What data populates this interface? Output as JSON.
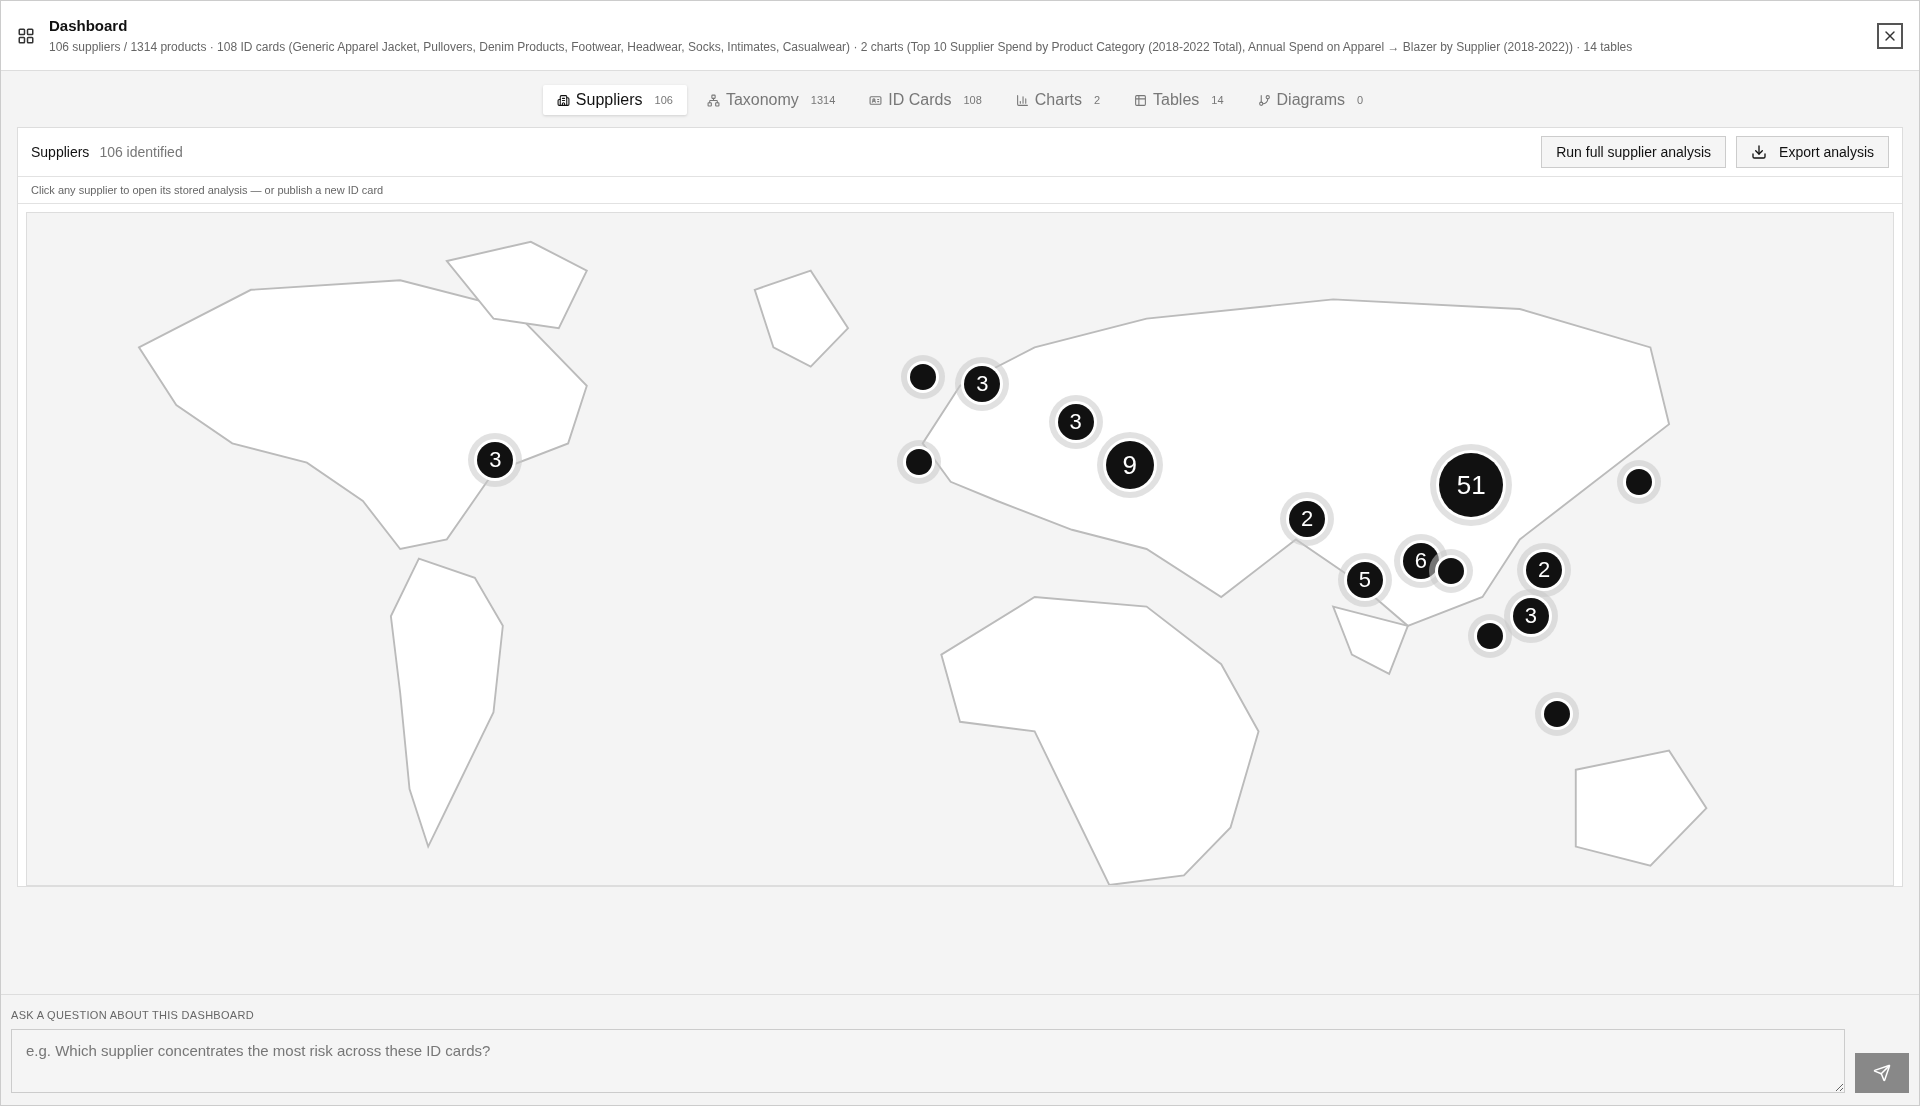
{
  "header": {
    "title": "Dashboard",
    "subtitle": "106 suppliers / 1314 products · 108 ID cards (Generic Apparel Jacket, Pullovers, Denim Products, Footwear, Headwear, Socks, Intimates, Casualwear) · 2 charts (Top 10 Supplier Spend by Product Category (2018-2022 Total), Annual Spend on Apparel → Blazer by Supplier (2018-2022)) · 14 tables"
  },
  "tabs": [
    {
      "kind": "suppliers",
      "label": "Suppliers",
      "count": "106",
      "selected": true
    },
    {
      "kind": "taxonomy",
      "label": "Taxonomy",
      "count": "1314",
      "selected": false
    },
    {
      "kind": "idcards",
      "label": "ID Cards",
      "count": "108",
      "selected": false
    },
    {
      "kind": "charts",
      "label": "Charts",
      "count": "2",
      "selected": false
    },
    {
      "kind": "tables",
      "label": "Tables",
      "count": "14",
      "selected": false
    },
    {
      "kind": "diagrams",
      "label": "Diagrams",
      "count": "0",
      "selected": false
    }
  ],
  "panel": {
    "title": "Suppliers",
    "count": "106 identified",
    "buttons": [
      {
        "kind": "plain",
        "label": "Run full supplier analysis"
      },
      {
        "kind": "export",
        "label": "Export analysis"
      }
    ],
    "hint": "Click any supplier to open its stored analysis — or publish a new ID card"
  },
  "map_markers": [
    {
      "kind": "cluster",
      "label": "3"
    },
    {
      "kind": "point"
    },
    {
      "kind": "cluster",
      "label": "3"
    },
    {
      "kind": "point"
    },
    {
      "kind": "cluster",
      "label": "3"
    },
    {
      "kind": "cluster",
      "label": "9"
    },
    {
      "kind": "cluster",
      "label": "51"
    },
    {
      "kind": "point"
    },
    {
      "kind": "cluster",
      "label": "2"
    },
    {
      "kind": "cluster",
      "label": "5"
    },
    {
      "kind": "cluster",
      "label": "6"
    },
    {
      "kind": "point"
    },
    {
      "kind": "cluster",
      "label": "2"
    },
    {
      "kind": "cluster",
      "label": "3"
    },
    {
      "kind": "point"
    },
    {
      "kind": "point"
    }
  ],
  "question": {
    "label": "ASK A QUESTION ABOUT THIS DASHBOARD",
    "placeholder": "e.g. Which supplier concentrates the most risk across these ID cards?"
  }
}
